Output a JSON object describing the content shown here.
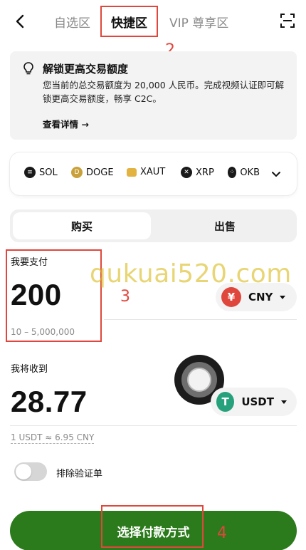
{
  "header": {
    "tabs": [
      {
        "label": "自选区",
        "active": false
      },
      {
        "label": "快捷区",
        "active": true
      },
      {
        "label": "VIP 尊享区",
        "active": false
      }
    ]
  },
  "annotations": {
    "n2": "2",
    "n3": "3",
    "n4": "4"
  },
  "notice": {
    "title": "解锁更高交易额度",
    "body": "您当前的总交易额度为 20,000 人民币。完成视频认证即可解锁更高交易额度，畅享 C2C。",
    "link": "查看详情 →"
  },
  "coins": [
    {
      "symbol": "SOL",
      "color": "#1a1a1a"
    },
    {
      "symbol": "DOGE",
      "color": "#c9a13a"
    },
    {
      "symbol": "XAUT",
      "color": "#e3b341"
    },
    {
      "symbol": "XRP",
      "color": "#1a1a1a"
    },
    {
      "symbol": "OKB",
      "color": "#1a1a1a"
    }
  ],
  "trade_tabs": {
    "buy": "购买",
    "sell": "出售",
    "active": "buy"
  },
  "pay": {
    "label": "我要支付",
    "amount": "200",
    "range": "10 – 5,000,000",
    "currency": "CNY",
    "currency_symbol": "¥",
    "currency_color": "#e0473c"
  },
  "receive": {
    "label": "我将收到",
    "amount": "28.77",
    "currency": "USDT",
    "currency_symbol": "T",
    "currency_color": "#26a17b",
    "rate": "1 USDT ≈ 6.95 CNY"
  },
  "filter": {
    "label": "排除验证单",
    "enabled": false
  },
  "cta": {
    "label": "选择付款方式"
  },
  "watermark": "qukuai520.com"
}
